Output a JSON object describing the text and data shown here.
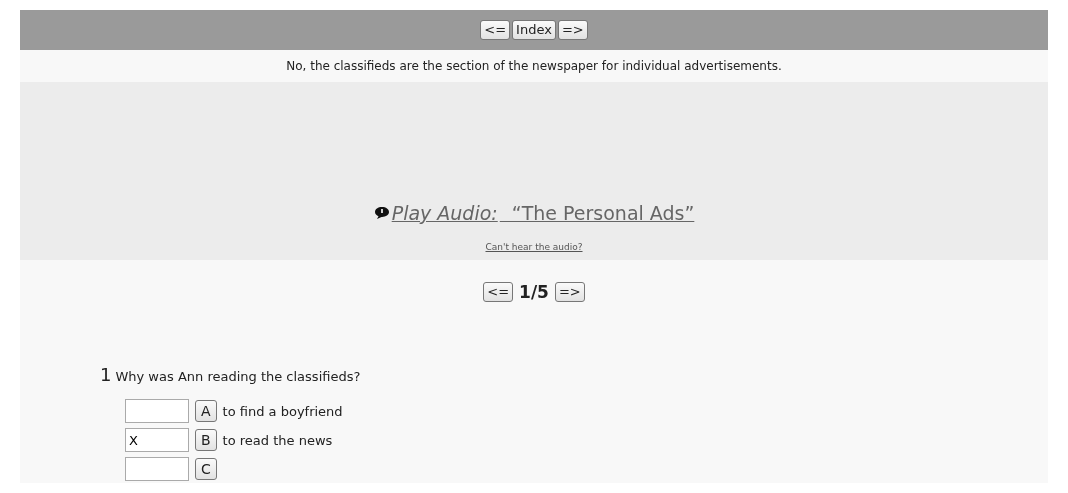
{
  "top_nav": {
    "prev": "<=",
    "index": "Index",
    "next": "=>"
  },
  "feedback": "No, the classifieds are the section of the newspaper for individual advertisements.",
  "audio": {
    "link_label": "Play Audio:",
    "title": "“The Personal Ads”",
    "help_link": "Can't hear the audio?"
  },
  "pager": {
    "prev": "<=",
    "position": "1/5",
    "next": "=>"
  },
  "question": {
    "number": "1",
    "text": "Why was Ann reading the classifieds?",
    "options": [
      {
        "letter": "A",
        "text": "to find a boyfriend"
      },
      {
        "answer": "X",
        "letter": "B",
        "text": "to read the news"
      },
      {
        "letter": "C"
      }
    ]
  }
}
